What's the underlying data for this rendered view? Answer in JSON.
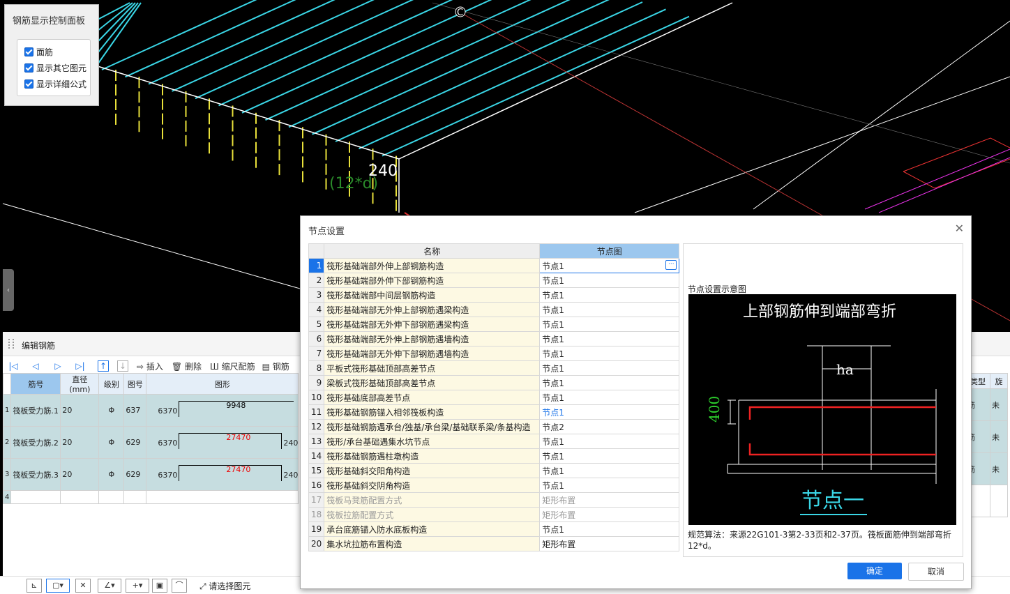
{
  "cad": {
    "dim_value": "240",
    "dim_formula": "(12*d)",
    "axis_label": "C"
  },
  "control_panel": {
    "title": "钢筋显示控制面板",
    "options": [
      "面筋",
      "显示其它图元",
      "显示详细公式"
    ]
  },
  "edit_panel": {
    "title": "编辑钢筋",
    "toolbar": {
      "insert": "插入",
      "delete": "删除",
      "scale": "缩尺配筋",
      "rebar": "钢筋"
    },
    "columns": [
      "筋号",
      "直径(mm)",
      "级别",
      "图号",
      "图形"
    ],
    "right_columns": [
      "类型",
      "旋"
    ],
    "rows": [
      {
        "num": "1",
        "name": "筏板受力筋.1",
        "dia": "20",
        "grade": "Φ",
        "fig": "637",
        "left": "6370",
        "mid": "9948",
        "right": "",
        "type": "筋",
        "rot": "未"
      },
      {
        "num": "2",
        "name": "筏板受力筋.2",
        "dia": "20",
        "grade": "Φ",
        "fig": "629",
        "left": "6370",
        "mid": "27470",
        "right": "240",
        "type": "筋",
        "rot": "未"
      },
      {
        "num": "3",
        "name": "筏板受力筋.3",
        "dia": "20",
        "grade": "Φ",
        "fig": "629",
        "left": "6370",
        "mid": "27470",
        "right": "240",
        "type": "筋",
        "rot": "未"
      },
      {
        "num": "4",
        "name": "",
        "dia": "",
        "grade": "",
        "fig": "",
        "left": "",
        "mid": "",
        "right": "",
        "type": "",
        "rot": ""
      }
    ]
  },
  "bottom_bar": {
    "select_text": "请选择图元"
  },
  "dialog": {
    "title": "节点设置",
    "col_name": "名称",
    "col_node": "节点图",
    "rows": [
      {
        "n": "1",
        "name": "筏形基础端部外伸上部钢筋构造",
        "val": "节点1"
      },
      {
        "n": "2",
        "name": "筏形基础端部外伸下部钢筋构造",
        "val": "节点1"
      },
      {
        "n": "3",
        "name": "筏形基础端部中间层钢筋构造",
        "val": "节点1"
      },
      {
        "n": "4",
        "name": "筏形基础端部无外伸上部钢筋遇梁构造",
        "val": "节点1"
      },
      {
        "n": "5",
        "name": "筏形基础端部无外伸下部钢筋遇梁构造",
        "val": "节点1"
      },
      {
        "n": "6",
        "name": "筏形基础端部无外伸上部钢筋遇墙构造",
        "val": "节点1"
      },
      {
        "n": "7",
        "name": "筏形基础端部无外伸下部钢筋遇墙构造",
        "val": "节点1"
      },
      {
        "n": "8",
        "name": "平板式筏形基础顶部高差节点",
        "val": "节点1"
      },
      {
        "n": "9",
        "name": "梁板式筏形基础顶部高差节点",
        "val": "节点1"
      },
      {
        "n": "10",
        "name": "筏形基础底部高差节点",
        "val": "节点1"
      },
      {
        "n": "11",
        "name": "筏形基础钢筋锚入相邻筏板构造",
        "val": "节点1"
      },
      {
        "n": "12",
        "name": "筏形基础钢筋遇承台/独基/承台梁/基础联系梁/条基构造",
        "val": "节点2"
      },
      {
        "n": "13",
        "name": "筏形/承台基础遇集水坑节点",
        "val": "节点1"
      },
      {
        "n": "14",
        "name": "筏形基础钢筋遇柱墩构造",
        "val": "节点1"
      },
      {
        "n": "15",
        "name": "筏形基础斜交阳角构造",
        "val": "节点1"
      },
      {
        "n": "16",
        "name": "筏形基础斜交阴角构造",
        "val": "节点1"
      },
      {
        "n": "17",
        "name": "筏板马凳筋配置方式",
        "val": "矩形布置"
      },
      {
        "n": "18",
        "name": "筏板拉筋配置方式",
        "val": "矩形布置"
      },
      {
        "n": "19",
        "name": "承台底筋锚入防水底板构造",
        "val": "节点1"
      },
      {
        "n": "20",
        "name": "集水坑拉筋布置构造",
        "val": "矩形布置"
      }
    ],
    "preview_label": "节点设置示意图",
    "preview": {
      "heading": "上部钢筋伸到端部弯折",
      "ha": "ha",
      "dim": "400",
      "caption": "节点一"
    },
    "rule_text": "规范算法：来源22G101-3第2-33页和2-37页。筏板面筋伸到端部弯折12*d。",
    "ok": "确定",
    "cancel": "取消"
  }
}
